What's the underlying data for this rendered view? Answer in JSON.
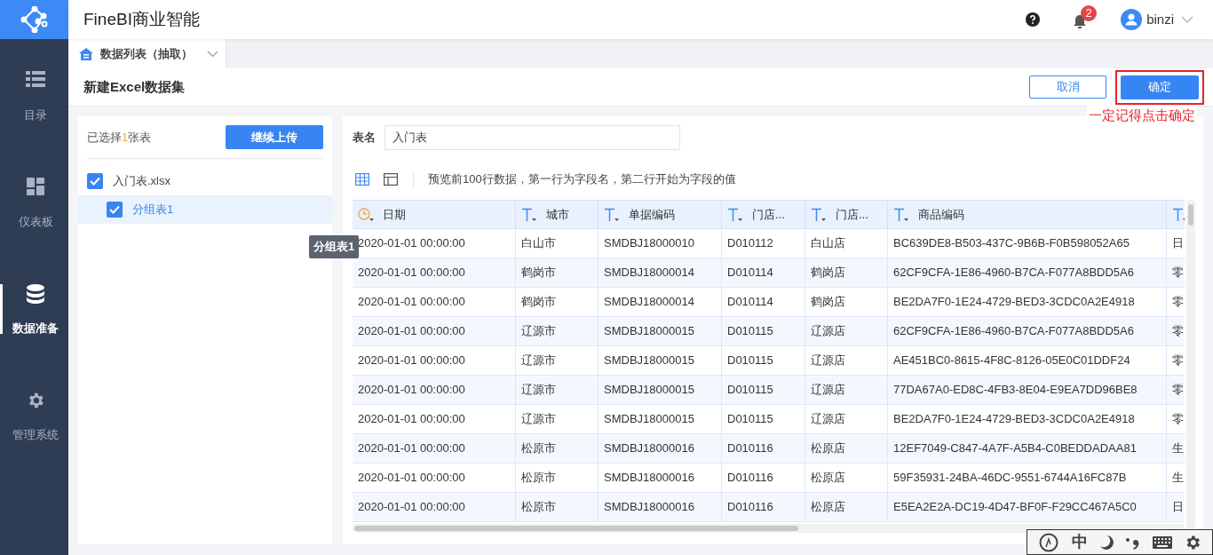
{
  "app": {
    "title": "FineBI商业智能",
    "notifications": "2",
    "user": "binzi"
  },
  "sidebar": {
    "items": [
      {
        "label": "目录",
        "kind": "list",
        "selected": false
      },
      {
        "label": "仪表板",
        "kind": "dashboard",
        "selected": false
      },
      {
        "label": "数据准备",
        "kind": "database",
        "selected": true
      },
      {
        "label": "管理系统",
        "kind": "gear",
        "selected": false
      }
    ]
  },
  "tab": {
    "label": "数据列表（抽取）"
  },
  "page": {
    "title": "新建Excel数据集",
    "cancel": "取消",
    "confirm": "确定",
    "annotation": "一定记得点击确定"
  },
  "left_panel": {
    "selected_prefix": "已选择",
    "selected_count": "1",
    "selected_suffix": "张表",
    "upload_button": "继续上传",
    "files": [
      {
        "label": "入门表.xlsx",
        "checked": true,
        "selected": false,
        "children": [
          {
            "label": "分组表1",
            "checked": true,
            "selected": true
          }
        ]
      }
    ],
    "tooltip": "分组表1"
  },
  "right_panel": {
    "name_label": "表名",
    "name_value": "入门表",
    "views": [
      {
        "kind": "grid",
        "selected": true
      },
      {
        "kind": "layout",
        "selected": false
      }
    ],
    "hint": "预览前100行数据，第一行为字段名，第二行开始为字段的值",
    "table": {
      "columns": [
        {
          "label": "日期",
          "kind": "date"
        },
        {
          "label": "城市",
          "kind": "text"
        },
        {
          "label": "单据编码",
          "kind": "text"
        },
        {
          "label": "门店...",
          "kind": "text"
        },
        {
          "label": "门店...",
          "kind": "text"
        },
        {
          "label": "商品编码",
          "kind": "text"
        },
        {
          "kind": "text"
        }
      ],
      "rows": [
        [
          "2020-01-01 00:00:00",
          "白山市",
          "SMDBJ18000010",
          "D010112",
          "白山店",
          "BC639DE8-B503-437C-9B6B-F0B598052A65",
          "日"
        ],
        [
          "2020-01-01 00:00:00",
          "鹤岗市",
          "SMDBJ18000014",
          "D010114",
          "鹤岗店",
          "62CF9CFA-1E86-4960-B7CA-F077A8BDD5A6",
          "零"
        ],
        [
          "2020-01-01 00:00:00",
          "鹤岗市",
          "SMDBJ18000014",
          "D010114",
          "鹤岗店",
          "BE2DA7F0-1E24-4729-BED3-3CDC0A2E4918",
          "零"
        ],
        [
          "2020-01-01 00:00:00",
          "辽源市",
          "SMDBJ18000015",
          "D010115",
          "辽源店",
          "62CF9CFA-1E86-4960-B7CA-F077A8BDD5A6",
          "零"
        ],
        [
          "2020-01-01 00:00:00",
          "辽源市",
          "SMDBJ18000015",
          "D010115",
          "辽源店",
          "AE451BC0-8615-4F8C-8126-05E0C01DDF24",
          "零"
        ],
        [
          "2020-01-01 00:00:00",
          "辽源市",
          "SMDBJ18000015",
          "D010115",
          "辽源店",
          "77DA67A0-ED8C-4FB3-8E04-E9EA7DD96BE8",
          "零"
        ],
        [
          "2020-01-01 00:00:00",
          "辽源市",
          "SMDBJ18000015",
          "D010115",
          "辽源店",
          "BE2DA7F0-1E24-4729-BED3-3CDC0A2E4918",
          "零"
        ],
        [
          "2020-01-01 00:00:00",
          "松原市",
          "SMDBJ18000016",
          "D010116",
          "松原店",
          "12EF7049-C847-4A7F-A5B4-C0BEDDADAA81",
          "生"
        ],
        [
          "2020-01-01 00:00:00",
          "松原市",
          "SMDBJ18000016",
          "D010116",
          "松原店",
          "59F35931-24BA-46DC-9551-6744A16FC87B",
          "生"
        ],
        [
          "2020-01-01 00:00:00",
          "松原市",
          "SMDBJ18000016",
          "D010116",
          "松原店",
          "E5EA2E2A-DC19-4D47-BF0F-F29CC467A5C0",
          "日"
        ]
      ]
    }
  },
  "ime_bar": {
    "mode": "中"
  }
}
